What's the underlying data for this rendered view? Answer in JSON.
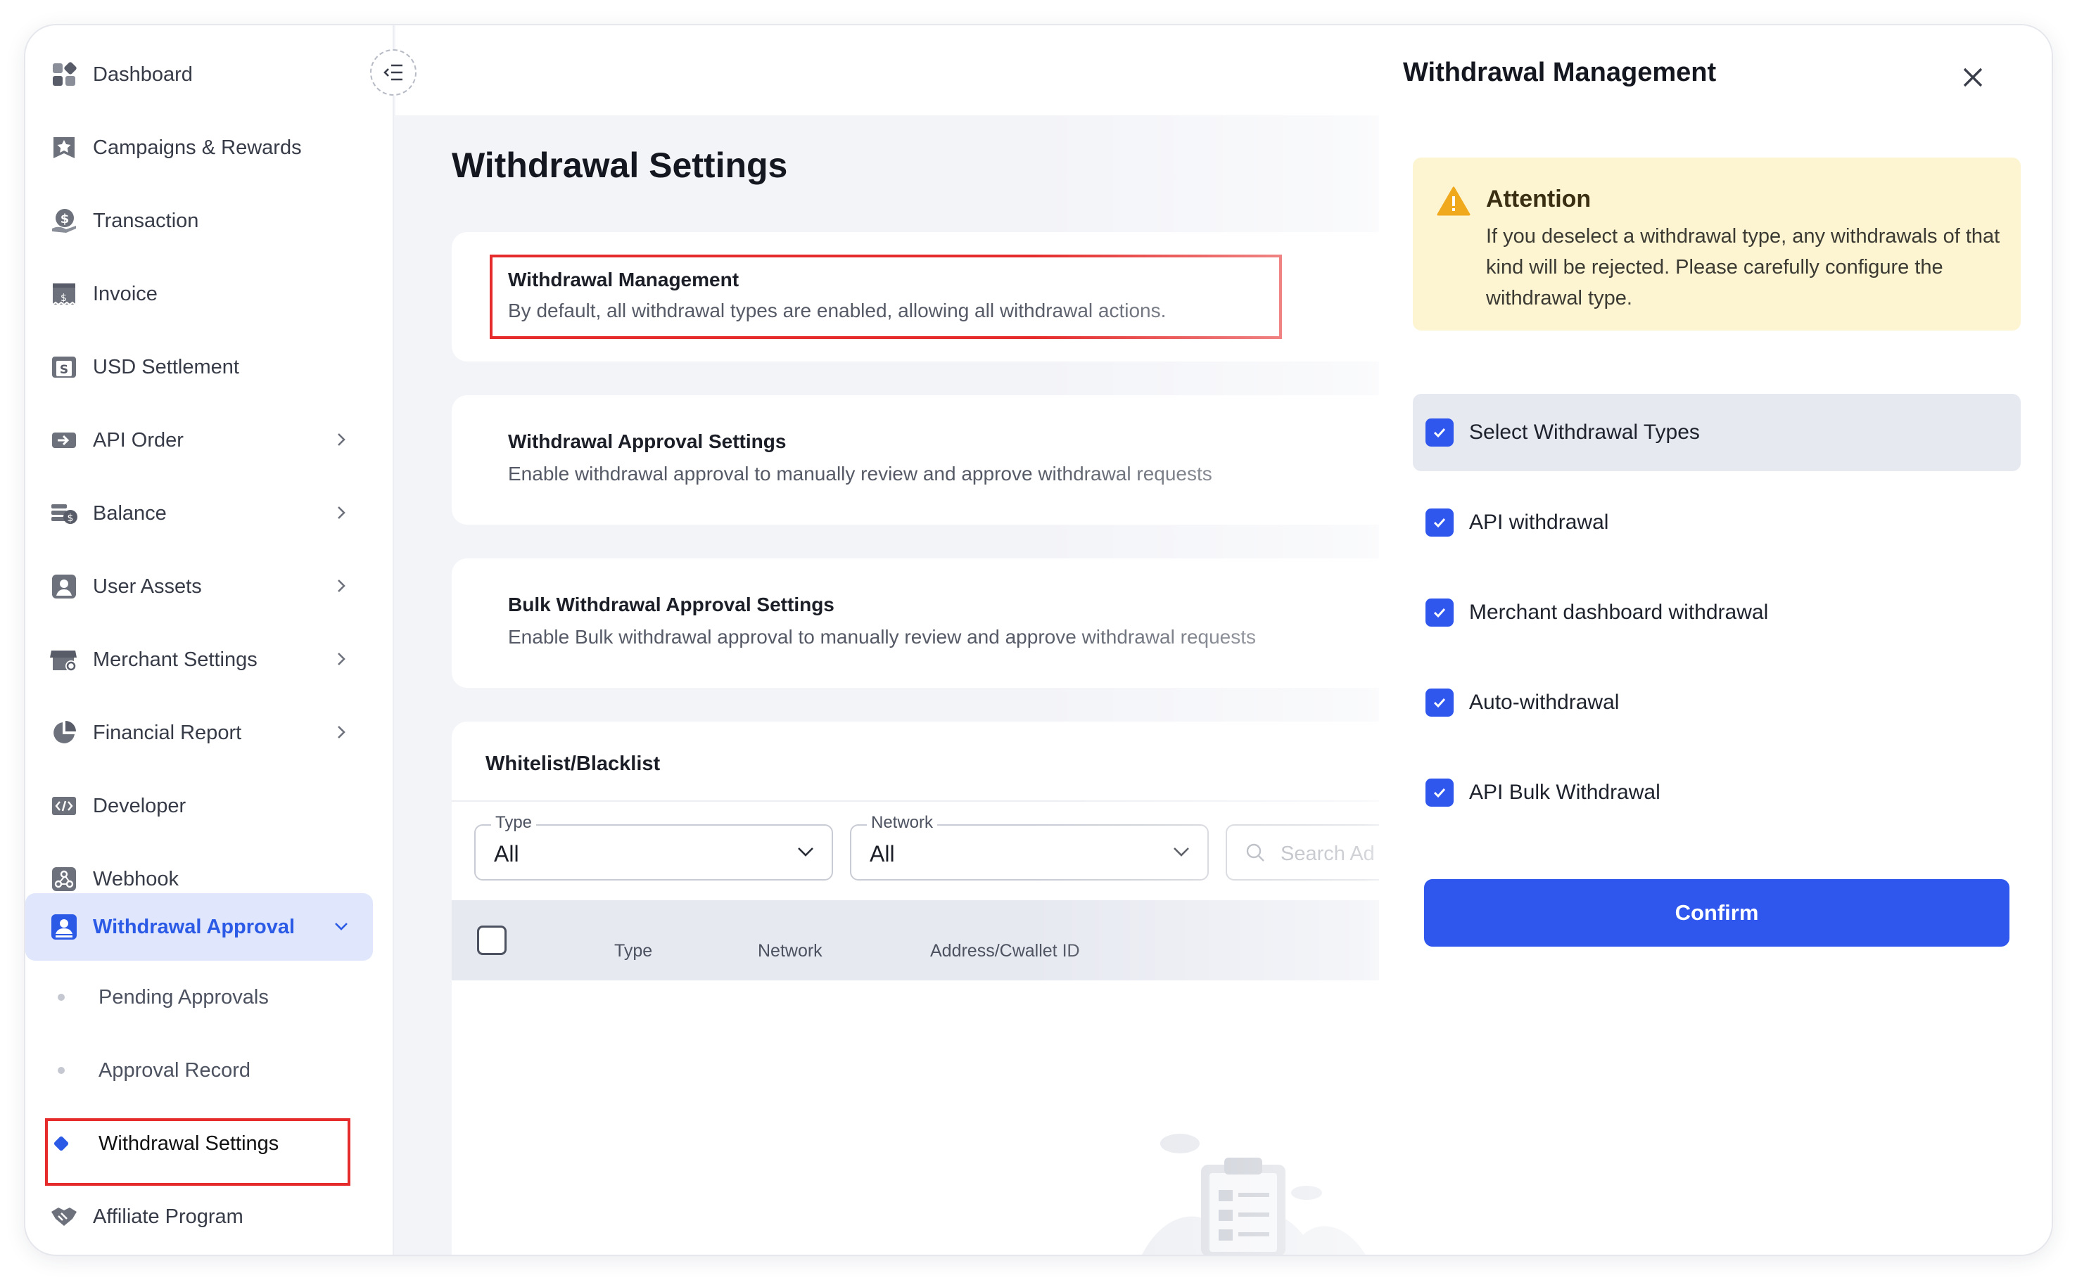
{
  "sidebar": {
    "items": [
      {
        "label": "Dashboard",
        "icon": "dashboard-icon"
      },
      {
        "label": "Campaigns & Rewards",
        "icon": "star-icon"
      },
      {
        "label": "Transaction",
        "icon": "coin-hand-icon"
      },
      {
        "label": "Invoice",
        "icon": "invoice-icon"
      },
      {
        "label": "USD Settlement",
        "icon": "settlement-icon"
      },
      {
        "label": "API Order",
        "icon": "api-order-icon"
      },
      {
        "label": "Balance",
        "icon": "balance-icon"
      },
      {
        "label": "User Assets",
        "icon": "user-icon"
      },
      {
        "label": "Merchant Settings",
        "icon": "store-icon"
      },
      {
        "label": "Financial Report",
        "icon": "pie-chart-icon"
      },
      {
        "label": "Developer",
        "icon": "code-icon"
      },
      {
        "label": "Webhook",
        "icon": "webhook-icon"
      },
      {
        "label": "Withdrawal Approval",
        "icon": "approval-icon"
      },
      {
        "label": "Affiliate Program",
        "icon": "handshake-icon"
      }
    ],
    "sub_items": [
      {
        "label": "Pending Approvals"
      },
      {
        "label": "Approval Record"
      },
      {
        "label": "Withdrawal Settings"
      }
    ]
  },
  "main": {
    "title": "Withdrawal Settings",
    "cards": [
      {
        "title": "Withdrawal Management",
        "desc": "By default, all withdrawal types are enabled, allowing all withdrawal actions."
      },
      {
        "title": "Withdrawal Approval Settings",
        "desc": "Enable withdrawal approval to manually review and approve withdrawal requests"
      },
      {
        "title": "Bulk Withdrawal Approval Settings",
        "desc": "Enable Bulk withdrawal approval to manually review and approve withdrawal requests"
      }
    ],
    "whitelist": {
      "title": "Whitelist/Blacklist",
      "type_label": "Type",
      "type_value": "All",
      "network_label": "Network",
      "network_value": "All",
      "search_placeholder": "Search Ad",
      "columns": [
        "Type",
        "Network",
        "Address/Cwallet ID"
      ]
    }
  },
  "drawer": {
    "title": "Withdrawal Management",
    "attention_title": "Attention",
    "attention_body": "If you deselect a withdrawal type, any withdrawals of that kind will be rejected. Please carefully configure the withdrawal type.",
    "select_all_label": "Select Withdrawal Types",
    "options": [
      {
        "label": "API withdrawal",
        "checked": true
      },
      {
        "label": "Merchant dashboard withdrawal",
        "checked": true
      },
      {
        "label": "Auto-withdrawal",
        "checked": true
      },
      {
        "label": "API Bulk Withdrawal",
        "checked": true
      }
    ],
    "confirm_label": "Confirm"
  },
  "colors": {
    "accent": "#2f57ee",
    "active_bg": "#e0e6fb",
    "attention_bg": "#fdf4d1",
    "highlight_border": "#e52b2b"
  }
}
